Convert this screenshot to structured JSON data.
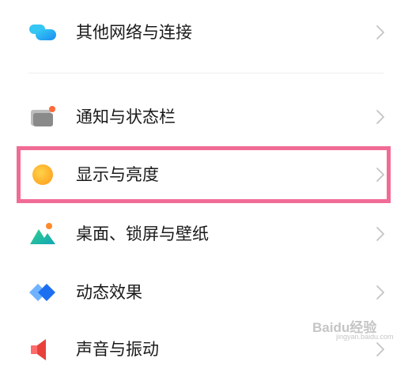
{
  "settings": {
    "items": [
      {
        "label": "其他网络与连接",
        "icon": "connection-icon"
      },
      {
        "label": "通知与状态栏",
        "icon": "notification-icon"
      },
      {
        "label": "显示与亮度",
        "icon": "brightness-icon"
      },
      {
        "label": "桌面、锁屏与壁纸",
        "icon": "wallpaper-icon"
      },
      {
        "label": "动态效果",
        "icon": "animation-icon"
      },
      {
        "label": "声音与振动",
        "icon": "sound-icon"
      }
    ]
  },
  "annotation": {
    "highlighted_item": "显示与亮度",
    "color": "#f06b95"
  },
  "watermark": {
    "text": "Baidu经验",
    "sub": "jingyan.baidu.com"
  }
}
